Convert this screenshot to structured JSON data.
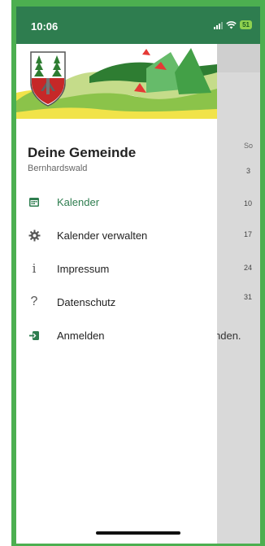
{
  "status": {
    "time": "10:06",
    "battery": "51"
  },
  "drawer": {
    "title": "Deine Gemeinde",
    "subtitle": "Bernhardswald",
    "items": [
      {
        "label": "Kalender",
        "icon": "calendar-icon",
        "active": true
      },
      {
        "label": "Kalender verwalten",
        "icon": "gear-icon",
        "active": false
      },
      {
        "label": "Impressum",
        "icon": "info-icon",
        "active": false
      },
      {
        "label": "Datenschutz",
        "icon": "question-icon",
        "active": false
      },
      {
        "label": "Anmelden",
        "icon": "login-icon",
        "active": false
      }
    ]
  },
  "background": {
    "day_header": "So",
    "dates": [
      "3",
      "10",
      "17",
      "24",
      "31"
    ],
    "partial_text": "nden."
  },
  "colors": {
    "primary": "#2e7d4f",
    "accent": "#4caf50",
    "coat_red": "#c62828"
  }
}
